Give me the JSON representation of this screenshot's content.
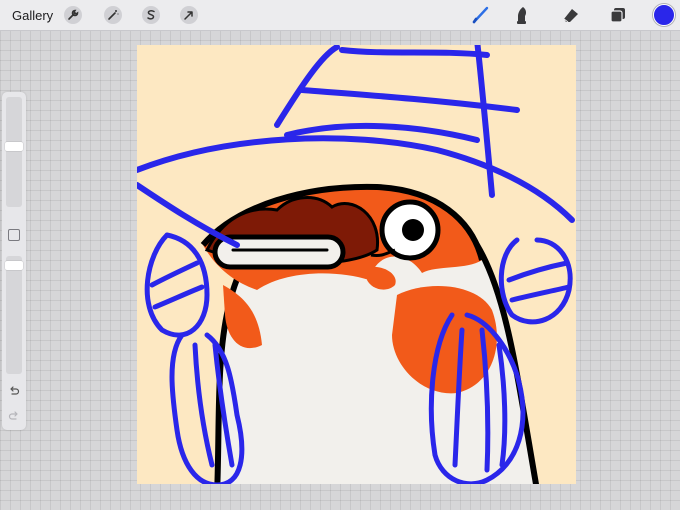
{
  "toolbar": {
    "gallery_label": "Gallery",
    "left_tools": [
      "wrench-icon",
      "magic-wand-icon",
      "selection-icon",
      "transform-arrow-icon"
    ],
    "right_tools": [
      "brush-icon",
      "smudge-icon",
      "eraser-icon",
      "layers-icon"
    ],
    "active_tool": "brush-icon",
    "active_color": "#2a26ea"
  },
  "sidebar": {
    "brush_size": 0.55,
    "brush_opacity": 0.95,
    "buttons": [
      "modify-button",
      "undo-button",
      "redo-button"
    ]
  },
  "canvas": {
    "background_color": "#fde8c2",
    "stroke_color": "#2a26ea",
    "fill_orange": "#f25a1a",
    "fill_white": "#f2f0ec"
  }
}
